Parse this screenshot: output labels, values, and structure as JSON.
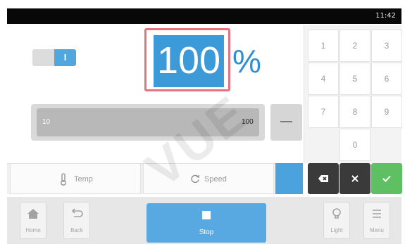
{
  "status_bar": {
    "time": "11:42"
  },
  "setpoint": {
    "value": "100",
    "unit": "%",
    "toggle_label": "I"
  },
  "range": {
    "min": "10",
    "max": "100",
    "fill_fraction": 1.0
  },
  "keypad": {
    "keys": [
      "1",
      "2",
      "3",
      "4",
      "5",
      "6",
      "7",
      "8",
      "9",
      "0"
    ],
    "backspace_icon": "backspace-icon",
    "clear_icon": "x-icon",
    "confirm_icon": "check-icon"
  },
  "mode_tabs": [
    {
      "label": "Temp",
      "icon": "thermometer-icon"
    },
    {
      "label": "Speed",
      "icon": "rotate-icon"
    }
  ],
  "nav": {
    "home": "Home",
    "back": "Back",
    "stop": "Stop",
    "light": "Light",
    "menu": "Menu"
  },
  "watermark": "VUE",
  "colors": {
    "accent": "#3c9ad8",
    "selection_border": "#e3737f",
    "confirm": "#5fbf63",
    "dark_button": "#3a3a3a"
  }
}
